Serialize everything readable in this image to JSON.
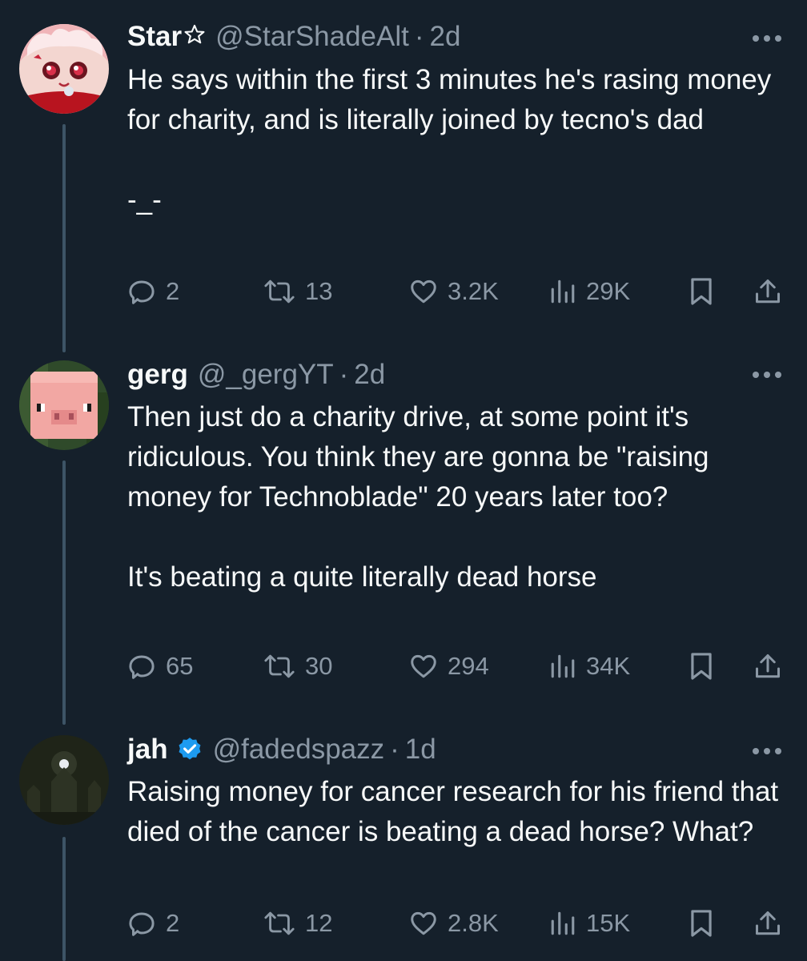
{
  "tweets": [
    {
      "name": "Star",
      "handle": "@StarShadeAlt",
      "separator": "·",
      "time": "2d",
      "body": "He says within the first 3 minutes he's rasing money for charity, and is literally joined by tecno's dad\n\n-_-",
      "replies": "2",
      "retweets": "13",
      "likes": "3.2K",
      "views": "29K",
      "avatar_icon": "anime-character-avatar"
    },
    {
      "name": "gerg",
      "handle": "@_gergYT",
      "separator": "·",
      "time": "2d",
      "body": "Then just do a charity drive, at some point it's ridiculous. You think they are gonna be \"raising money for Technoblade\" 20 years later too?\n\nIt's beating a quite literally dead horse",
      "replies": "65",
      "retweets": "30",
      "likes": "294",
      "views": "34K",
      "avatar_icon": "minecraft-pig-avatar"
    },
    {
      "name": "jah",
      "handle": "@fadedspazz",
      "separator": "·",
      "time": "1d",
      "body": "Raising money for cancer research for his friend that died of the cancer is beating a dead horse? What?",
      "replies": "2",
      "retweets": "12",
      "likes": "2.8K",
      "views": "15K",
      "avatar_icon": "dark-castle-moon-avatar"
    }
  ],
  "colors": {
    "background": "#15202b",
    "text": "#f7f9f9",
    "muted": "#8b98a5",
    "thread_line": "#3d5466",
    "verified": "#1d9bf0"
  }
}
